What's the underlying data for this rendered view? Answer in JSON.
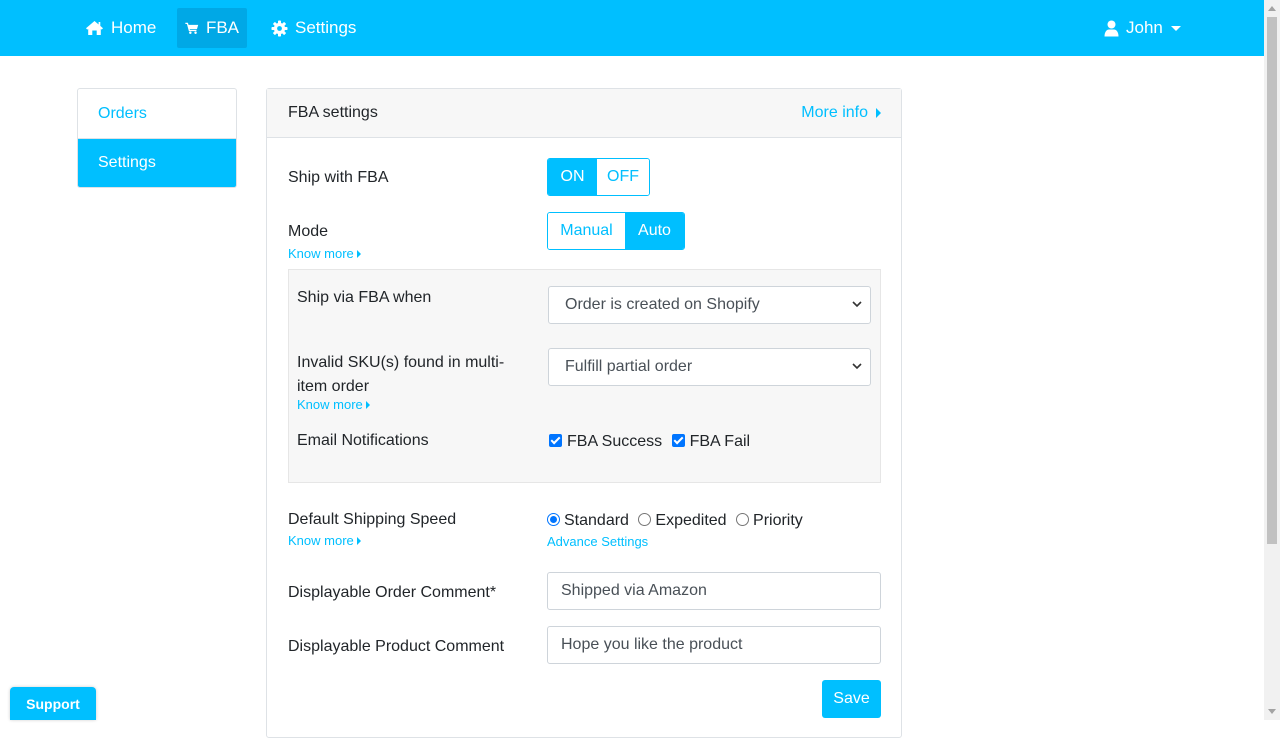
{
  "nav": {
    "home": "Home",
    "fba": "FBA",
    "settings": "Settings",
    "user": "John"
  },
  "sidebar": {
    "items": [
      {
        "label": "Orders"
      },
      {
        "label": "Settings"
      }
    ]
  },
  "card": {
    "title": "FBA settings",
    "more_info": "More info"
  },
  "ship_with_fba": {
    "label": "Ship with FBA",
    "on": "ON",
    "off": "OFF",
    "selected": "ON"
  },
  "mode": {
    "label": "Mode",
    "know_more": "Know more",
    "manual": "Manual",
    "auto": "Auto",
    "selected": "Auto"
  },
  "ship_via": {
    "label": "Ship via FBA when",
    "value": "Order is created on Shopify"
  },
  "invalid_sku": {
    "label_line1": "Invalid SKU(s) found in multi-",
    "label_line2": "item order",
    "know_more": "Know more",
    "value": "Fulfill partial order"
  },
  "email": {
    "label": "Email Notifications",
    "success": "FBA Success",
    "fail": "FBA Fail",
    "success_checked": true,
    "fail_checked": true
  },
  "shipping_speed": {
    "label": "Default Shipping Speed",
    "know_more": "Know more",
    "options": [
      "Standard",
      "Expedited",
      "Priority"
    ],
    "selected": "Standard",
    "advance": "Advance Settings"
  },
  "order_comment": {
    "label": "Displayable Order Comment*",
    "value": "Shipped via Amazon"
  },
  "product_comment": {
    "label": "Displayable Product Comment",
    "value": "Hope you like the product"
  },
  "save": "Save",
  "support": "Support",
  "colors": {
    "accent": "#00bfff",
    "panel": "#f7f7f7",
    "checkbox": "#0075ff"
  }
}
